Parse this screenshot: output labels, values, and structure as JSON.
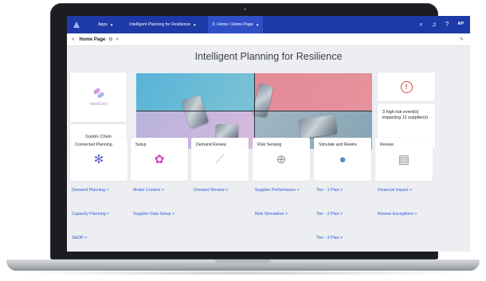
{
  "nav": {
    "apps_label": "Apps",
    "tab1_label": "Intelligent Planning for Resilience",
    "tab2_label": "0. Home / Home Page",
    "right_icons": [
      "search-icon",
      "bell-icon",
      "help-icon"
    ],
    "user_initials": "AP"
  },
  "subheader": {
    "back": "<",
    "title": "Home Page"
  },
  "page": {
    "heading": "Intelligent Planning for Resilience"
  },
  "brand": {
    "logo_text": "VapeCorp"
  },
  "supply_chain_label": "Supply Chain",
  "alert": {
    "icon_text": "!",
    "risk_text": "3 high risk event(s) impacting 12 supplier(s)"
  },
  "tiles": [
    {
      "label": "Connected Planning",
      "icon": "network-icon",
      "color": "#5a5fce",
      "links": [
        "Demand Planning >",
        "Capacity Planning >",
        "S&OP >"
      ]
    },
    {
      "label": "Setup",
      "icon": "gear-icon",
      "color": "#d43fbb",
      "links": [
        "Model Context >",
        "Supplier Data Setup >"
      ]
    },
    {
      "label": "Demand Review",
      "icon": "trend-chart-icon",
      "color": "#d8a6d9",
      "links": [
        "Demand Review >"
      ]
    },
    {
      "label": "Risk Sensing",
      "icon": "magnify-pulse-icon",
      "color": "#8c8f96",
      "links": [
        "Supplier Performance >",
        "Risk Simulation >"
      ]
    },
    {
      "label": "Simulate and Rewire",
      "icon": "brain-head-icon",
      "color": "#5c88c9",
      "links": [
        "Tier - 1 Plan >",
        "Tier - 2 Plan >",
        "Tier - 3 Plan >"
      ]
    },
    {
      "label": "Review",
      "icon": "checklist-icon",
      "color": "#8a8f99",
      "links": [
        "Financial Impact >",
        "Review Exceptions >"
      ]
    }
  ],
  "colors": {
    "nav_bg": "#1e3aa8",
    "link": "#2a5bd7",
    "alert": "#d9453c"
  }
}
